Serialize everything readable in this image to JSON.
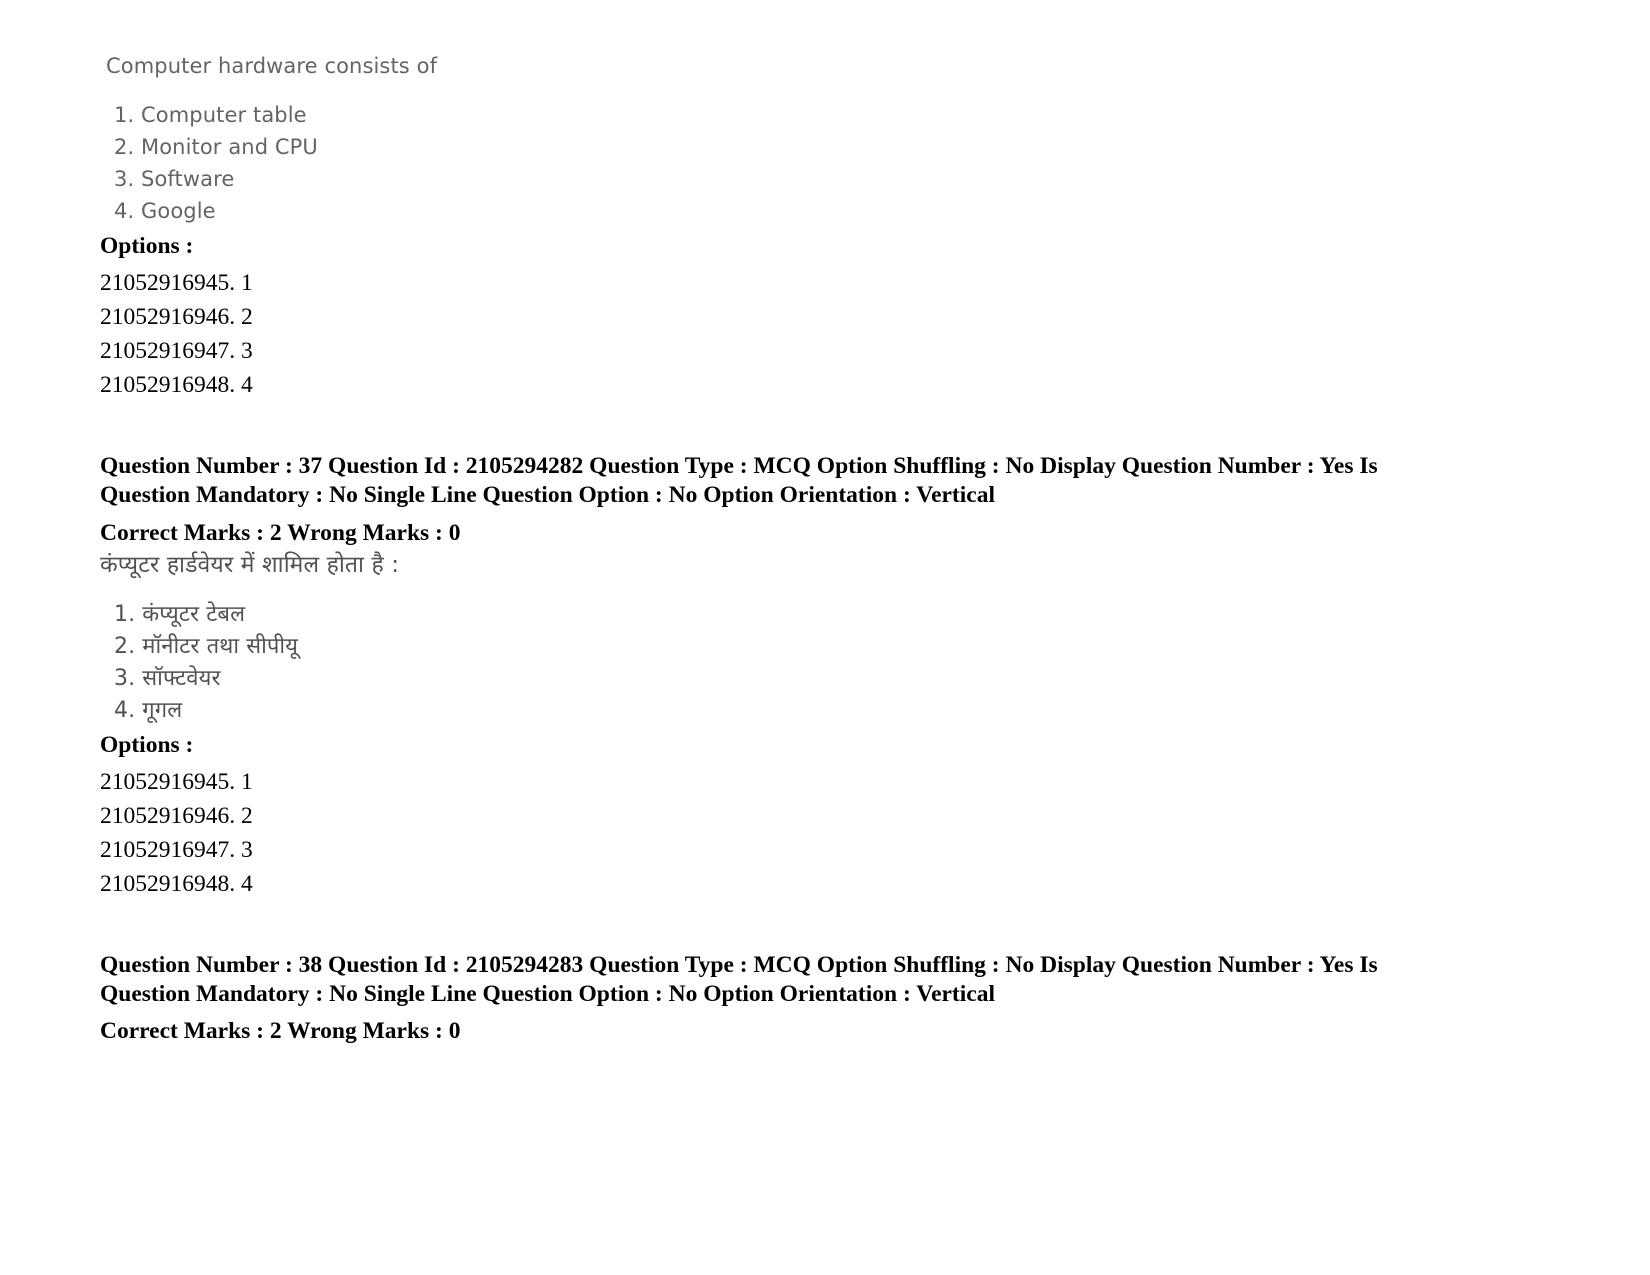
{
  "document": {
    "type": "exam-question-paper-scan",
    "language_pair": "English / Hindi"
  },
  "question_36_continued": {
    "stem": "Computer hardware consists of",
    "choices": [
      "1. Computer table",
      "2. Monitor and CPU",
      "3. Software",
      "4. Google"
    ],
    "options_label": "Options :",
    "options": [
      "21052916945. 1",
      "21052916946. 2",
      "21052916947. 3",
      "21052916948. 4"
    ]
  },
  "question_37": {
    "meta_line_1": "Question Number : 37 Question Id : 2105294282 Question Type : MCQ Option Shuffling : No Display Question Number : Yes Is",
    "meta_line_2": "Question Mandatory : No Single Line Question Option : No Option Orientation : Vertical",
    "marks_line": "Correct Marks : 2 Wrong Marks : 0",
    "stem_hi": "कंप्यूटर हार्डवेयर में शामिल होता है :",
    "choices_hi": [
      "1. कंप्यूटर टेबल",
      "2. मॉनीटर तथा सीपीयू",
      "3. सॉफ्टवेयर",
      "4. गूगल"
    ],
    "options_label": "Options :",
    "options": [
      "21052916945. 1",
      "21052916946. 2",
      "21052916947. 3",
      "21052916948. 4"
    ]
  },
  "question_38": {
    "meta_line_1": "Question Number : 38 Question Id : 2105294283 Question Type : MCQ Option Shuffling : No Display Question Number : Yes Is",
    "meta_line_2": "Question Mandatory : No Single Line Question Option : No Option Orientation : Vertical",
    "marks_line": "Correct Marks : 2 Wrong Marks : 0"
  }
}
